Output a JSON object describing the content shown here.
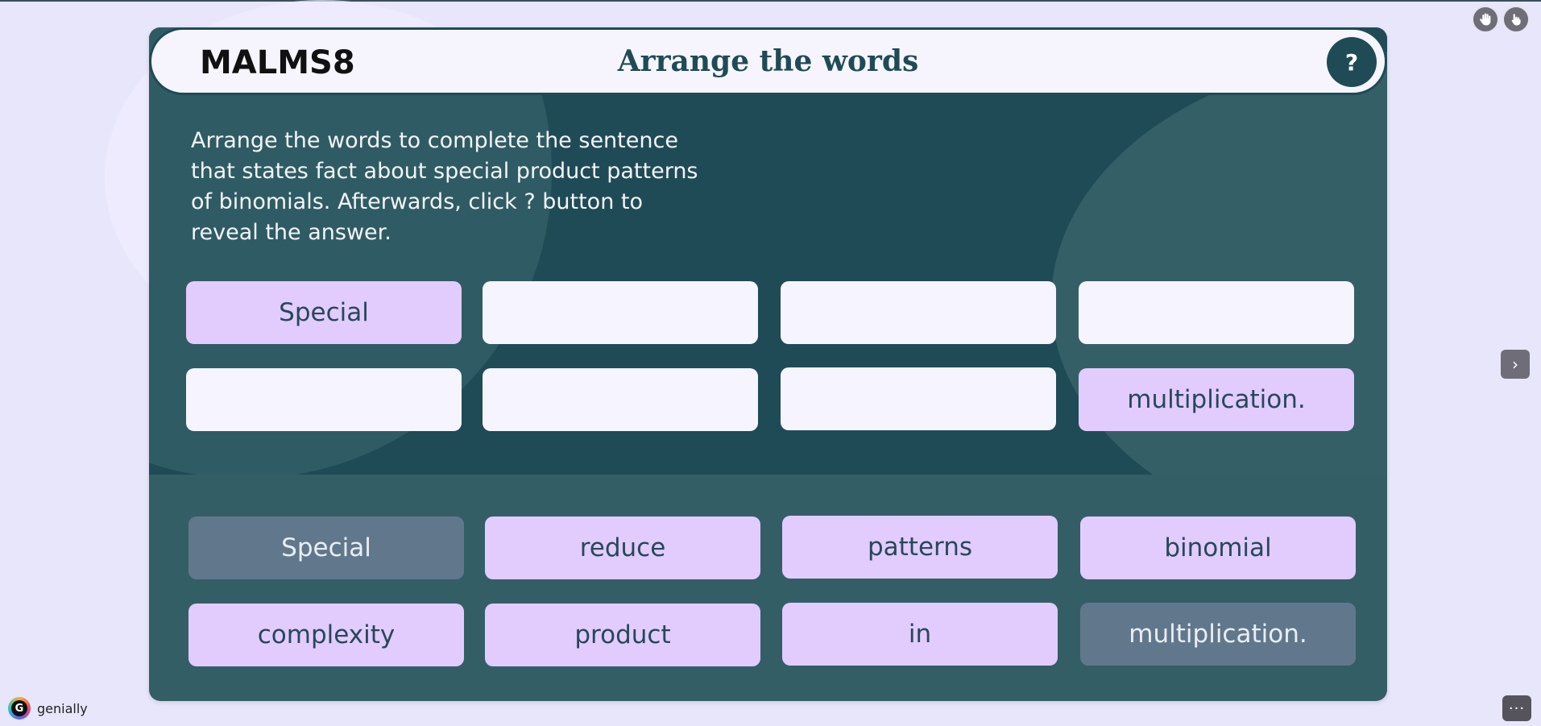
{
  "header": {
    "code": "MALMS8",
    "title": "Arrange the words",
    "help_label": "?"
  },
  "instructions": "Arrange the words to complete the sentence that states fact about special product patterns of binomials. Afterwards, click ? button to reveal the answer.",
  "answer_slots": [
    {
      "text": "Special",
      "filled": true
    },
    {
      "text": "",
      "filled": false
    },
    {
      "text": "",
      "filled": false
    },
    {
      "text": "",
      "filled": false
    },
    {
      "text": "",
      "filled": false
    },
    {
      "text": "",
      "filled": false
    },
    {
      "text": "",
      "filled": false
    },
    {
      "text": "multiplication.",
      "filled": true
    }
  ],
  "word_bank": [
    {
      "text": "Special",
      "used": true
    },
    {
      "text": "reduce",
      "used": false
    },
    {
      "text": "patterns",
      "used": false
    },
    {
      "text": "binomial",
      "used": false
    },
    {
      "text": "complexity",
      "used": false
    },
    {
      "text": "product",
      "used": false
    },
    {
      "text": "in",
      "used": false
    },
    {
      "text": "multiplication.",
      "used": true
    }
  ],
  "controls": {
    "hand_icon": "hand-icon",
    "pointer_icon": "pointer-icon",
    "next_label": "›",
    "more_label": "···"
  },
  "brand": {
    "logo_letter": "G",
    "name": "genially"
  },
  "colors": {
    "page_bg": "#e8e6fb",
    "card_dark": "#1f4b57",
    "card_mid": "#345e66",
    "slot_empty": "#f6f4fe",
    "tile": "#e2ccfd",
    "tile_used": "#61788c"
  }
}
